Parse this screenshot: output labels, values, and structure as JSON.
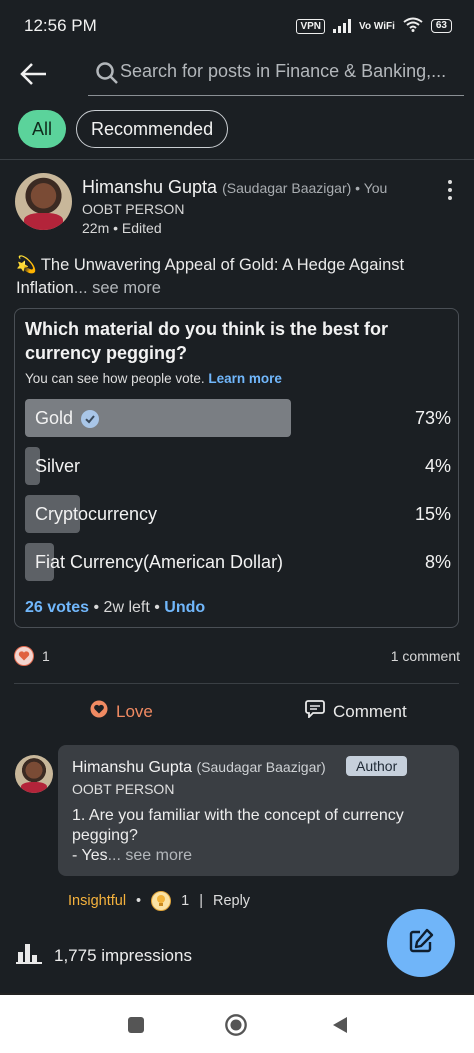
{
  "status_bar": {
    "time": "12:56 PM",
    "vpn": "VPN",
    "vowifi": "Vo WiFi",
    "battery": "63"
  },
  "search": {
    "placeholder": "Search for posts in Finance & Banking,..."
  },
  "filters": {
    "all": "All",
    "recommended": "Recommended"
  },
  "post": {
    "author": "Himanshu Gupta",
    "author_sub": "(Saudagar Baazigar) • You",
    "headline": "OOBT PERSON",
    "time": "22m • Edited",
    "emoji": "💫",
    "text": "The Unwavering Appeal of Gold: A Hedge Against Inflation",
    "see_more": "... see more"
  },
  "poll": {
    "question": "Which material do you think is the best for currency pegging?",
    "note": "You can see how people vote.",
    "learn_more": "Learn more",
    "options": [
      {
        "label": "Gold",
        "percent": "73%",
        "value": 73,
        "selected": true
      },
      {
        "label": "Silver",
        "percent": "4%",
        "value": 4,
        "selected": false
      },
      {
        "label": "Cryptocurrency",
        "percent": "15%",
        "value": 15,
        "selected": false
      },
      {
        "label": "Fiat Currency(American Dollar)",
        "percent": "8%",
        "value": 8,
        "selected": false
      }
    ],
    "votes": "26 votes",
    "time_left": " • 2w left • ",
    "undo": "Undo"
  },
  "engagement": {
    "reaction_count": "1",
    "comment_count": "1 comment"
  },
  "actions": {
    "love": "Love",
    "comment": "Comment"
  },
  "comment": {
    "author": "Himanshu Gupta",
    "author_sub": "(Saudagar Baazigar)",
    "badge": "Author",
    "headline": "OOBT PERSON",
    "text": "1. Are you familiar with the concept of currency pegging?\n- Yes",
    "see_more": "... see more",
    "reaction": "Insightful",
    "reaction_count": "1",
    "reply": "Reply"
  },
  "impressions": "1,775 impressions",
  "colors": {
    "background": "#1b1f23",
    "accent_green": "#5bd39b",
    "link_blue": "#71b7fb",
    "love_orange": "#f08a62",
    "insightful_amber": "#f5b23d",
    "fab_blue": "#70b5f9"
  }
}
